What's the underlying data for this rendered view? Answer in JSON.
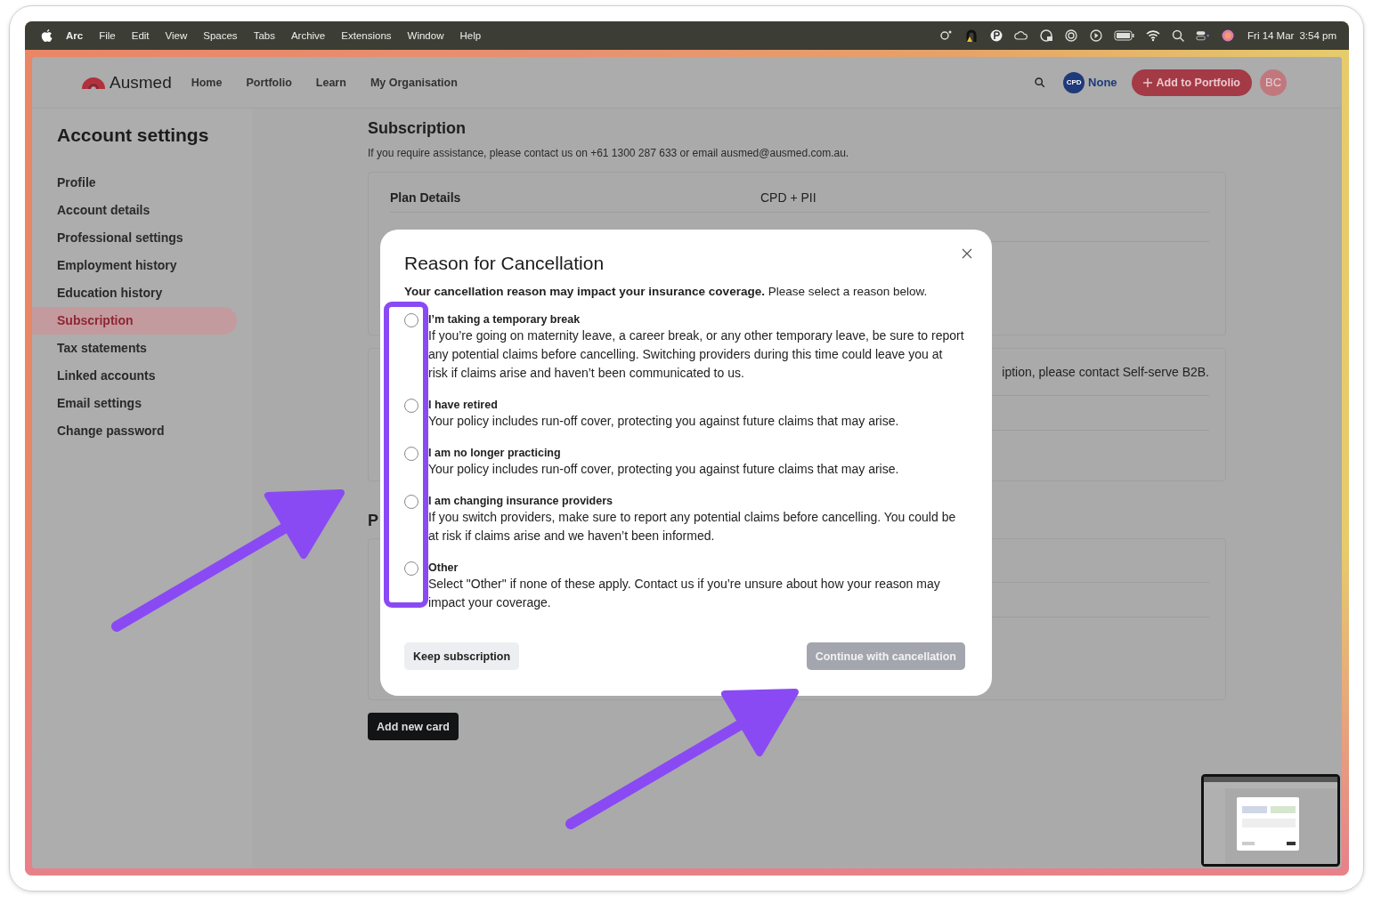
{
  "menu_bar": {
    "app_name": "Arc",
    "items": [
      "File",
      "Edit",
      "View",
      "Spaces",
      "Tabs",
      "Archive",
      "Extensions",
      "Window",
      "Help"
    ],
    "date": "Fri 14 Mar",
    "time": "3:54 pm"
  },
  "header": {
    "brand": "Ausmed",
    "nav": [
      "Home",
      "Portfolio",
      "Learn",
      "My Organisation"
    ],
    "cpd_badge": "CPD",
    "cpd_label": "None",
    "add_button": "Add to Portfolio",
    "avatar": "BC"
  },
  "sidebar": {
    "title": "Account settings",
    "items": [
      {
        "label": "Profile",
        "selected": false
      },
      {
        "label": "Account details",
        "selected": false
      },
      {
        "label": "Professional settings",
        "selected": false
      },
      {
        "label": "Employment history",
        "selected": false
      },
      {
        "label": "Education history",
        "selected": false
      },
      {
        "label": "Subscription",
        "selected": true
      },
      {
        "label": "Tax statements",
        "selected": false
      },
      {
        "label": "Linked accounts",
        "selected": false
      },
      {
        "label": "Email settings",
        "selected": false
      },
      {
        "label": "Change password",
        "selected": false
      }
    ]
  },
  "main": {
    "title": "Subscription",
    "help": "If you require assistance, please contact us on +61 1300 287 633 or email ausmed@ausmed.com.au.",
    "plan_rows": [
      {
        "label": "Plan Details",
        "value": "CPD + PII"
      }
    ],
    "notice": "iption, please contact Self-serve B2B.",
    "section_heading": "P",
    "add_card_button": "Add new card"
  },
  "modal": {
    "title": "Reason for Cancellation",
    "intro": "**Your cancellation reason may impact your insurance coverage.** Please select a reason below.",
    "options": [
      {
        "label": "I’m taking a temporary break",
        "description": "If you’re going on maternity leave, a career break, or any other temporary leave, be sure to report any potential claims before cancelling. Switching providers during this time could leave you at risk if claims arise and haven’t been communicated to us.",
        "selected": false
      },
      {
        "label": "I have retired",
        "description": "Your policy includes run-off cover, protecting you against future claims that may arise.",
        "selected": false
      },
      {
        "label": "I am no longer practicing",
        "description": "Your policy includes run-off cover, protecting you against future claims that may arise.",
        "selected": false
      },
      {
        "label": "I am changing insurance providers",
        "description": "If you switch providers, make sure to report any potential claims before cancelling. You could be at risk if claims arise and we haven’t been informed.",
        "selected": false
      },
      {
        "label": "Other",
        "description": "Select \"Other\" if none of these apply. Contact us if you’re unsure about how your reason may impact your coverage.",
        "selected": false
      }
    ],
    "keep_button": "Keep subscription",
    "continue_button": {
      "label": "Continue with cancellation",
      "disabled": true
    }
  }
}
